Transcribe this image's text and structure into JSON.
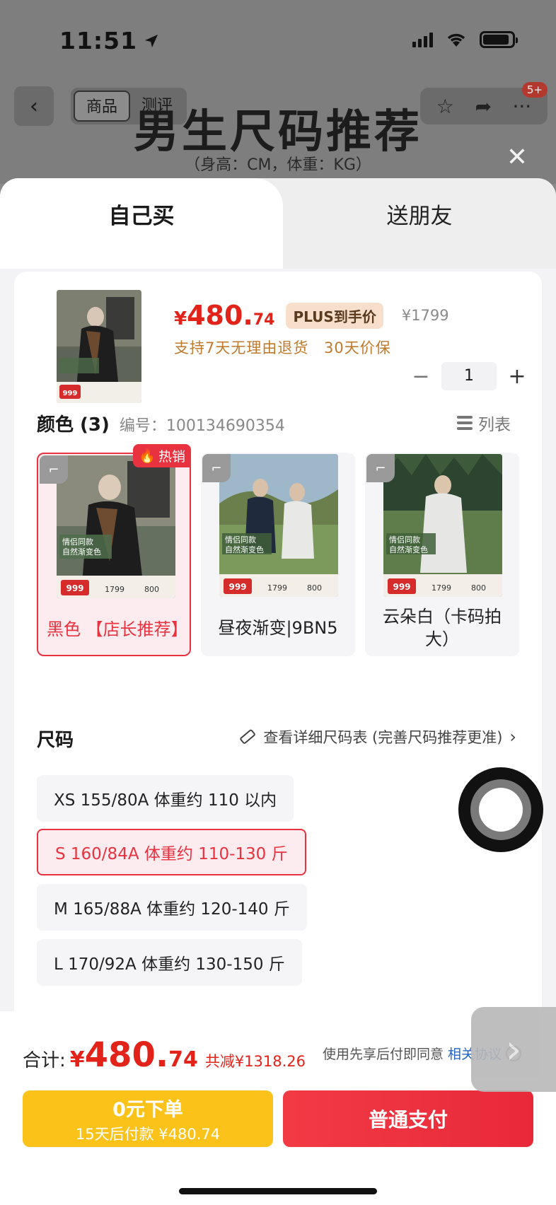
{
  "status_bar": {
    "time": "11:51"
  },
  "nav": {
    "segments": [
      "商品",
      "测评"
    ],
    "badge": "5+"
  },
  "background": {
    "title": "男生尺码推荐",
    "subtitle": "（身高：CM，体重：KG）"
  },
  "sheet": {
    "tabs": [
      "自己买",
      "送朋友"
    ],
    "product": {
      "price_currency": "¥",
      "price_int": "480.",
      "price_dec": "74",
      "plus_tag": "PLUS到手价",
      "original_price": "¥1799",
      "services": "支持7天无理由退货 30天价保",
      "quantity": "1",
      "thumb_badge": "999"
    },
    "color_section": {
      "title": "颜色 (3)",
      "code": "编号：100134690354",
      "list_label": "列表",
      "hot_label": "热销",
      "options": [
        {
          "label": "黑色 【店长推荐】",
          "selected": true
        },
        {
          "label": "昼夜渐变|9BN5",
          "selected": false
        },
        {
          "label": "云朵白（卡码拍大）",
          "selected": false
        }
      ],
      "img_badge": "999",
      "img_text1": "情侣同款",
      "img_text2": "自然渐变色",
      "img_price1": "1799",
      "img_price2": "800"
    },
    "size_section": {
      "title": "尺码",
      "chart_link": "查看详细尺码表 (完善尺码推荐更准)",
      "options": [
        {
          "label": "XS 155/80A 体重约 110 以内",
          "selected": false
        },
        {
          "label": "S 160/84A 体重约 110-130 斤",
          "selected": true
        },
        {
          "label": "M 165/88A 体重约 120-140 斤",
          "selected": false
        },
        {
          "label": "L 170/92A 体重约 130-150 斤",
          "selected": false
        }
      ]
    }
  },
  "bottom": {
    "total_label": "合计:",
    "total_currency": "¥",
    "total_int": "480.",
    "total_dec": "74",
    "saving": "共减¥1318.26",
    "agree_text": "使用先享后付即同意",
    "agree_link": "相关协议",
    "pay_later_line1": "0元下单",
    "pay_later_line2": "15天后付款 ¥480.74",
    "pay_label": "普通支付"
  },
  "colors": {
    "accent": "#e8323f",
    "price": "#e2231a",
    "pay_later": "#fbc21a",
    "link": "#2563c7"
  },
  "icons": [
    "location-arrow-icon",
    "signal-icon",
    "wifi-icon",
    "battery-icon",
    "back-chevron-icon",
    "star-icon",
    "share-icon",
    "more-icon",
    "close-icon",
    "list-icon",
    "fire-icon",
    "zoom-icon",
    "ruler-icon",
    "chevron-right-icon",
    "help-icon"
  ]
}
